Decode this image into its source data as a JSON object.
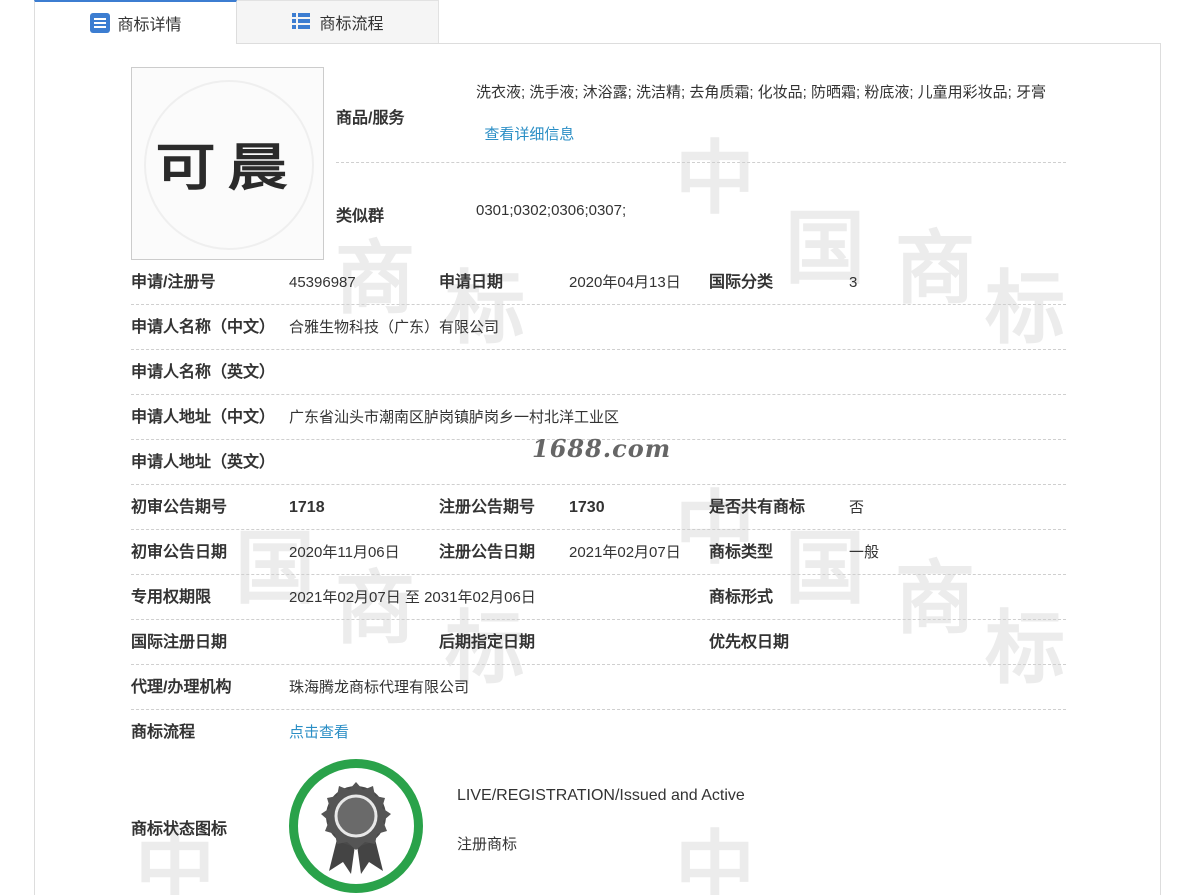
{
  "tabs": [
    {
      "label": "商标详情",
      "icon": "document-list-icon"
    },
    {
      "label": "商标流程",
      "icon": "grid-list-icon"
    }
  ],
  "logo": {
    "text": "可晨"
  },
  "goods": {
    "label": "商品/服务",
    "value": "洗衣液; 洗手液; 沐浴露; 洗洁精; 去角质霜; 化妆品; 防晒霜; 粉底液; 儿童用彩妆品; 牙膏",
    "detail_link": "查看详细信息"
  },
  "similar": {
    "label": "类似群",
    "value": "0301;0302;0306;0307;"
  },
  "fields": {
    "reg_no_label": "申请/注册号",
    "reg_no": "45396987",
    "apply_date_label": "申请日期",
    "apply_date": "2020年04月13日",
    "intl_class_label": "国际分类",
    "intl_class": "3",
    "applicant_cn_label": "申请人名称（中文）",
    "applicant_cn": "合雅生物科技（广东）有限公司",
    "applicant_en_label": "申请人名称（英文）",
    "applicant_en": "",
    "address_cn_label": "申请人地址（中文）",
    "address_cn": "广东省汕头市潮南区胪岗镇胪岗乡一村北洋工业区",
    "address_en_label": "申请人地址（英文）",
    "address_en": "",
    "prelim_no_label": "初审公告期号",
    "prelim_no": "1718",
    "reg_pub_no_label": "注册公告期号",
    "reg_pub_no": "1730",
    "shared_label": "是否共有商标",
    "shared": "否",
    "prelim_date_label": "初审公告日期",
    "prelim_date": "2020年11月06日",
    "reg_pub_date_label": "注册公告日期",
    "reg_pub_date": "2021年02月07日",
    "tm_type_label": "商标类型",
    "tm_type": "一般",
    "excl_period_label": "专用权期限",
    "excl_period": "2021年02月07日 至 2031年02月06日",
    "tm_form_label": "商标形式",
    "tm_form": "",
    "intl_reg_date_label": "国际注册日期",
    "intl_reg_date": "",
    "later_designation_label": "后期指定日期",
    "later_designation": "",
    "priority_date_label": "优先权日期",
    "priority_date": "",
    "agent_label": "代理/办理机构",
    "agent": "珠海腾龙商标代理有限公司",
    "flow_label": "商标流程",
    "flow_link": "点击查看"
  },
  "status": {
    "label": "商标状态图标",
    "en": "LIVE/REGISTRATION/Issued and Active",
    "cn": "注册商标",
    "icon": "award-ribbon-icon"
  },
  "overlay_text": "1688.com",
  "watermark": [
    "中",
    "国",
    "商",
    "标"
  ],
  "colors": {
    "accent": "#3c7dd1",
    "link": "#2a8ec5",
    "badge": "#2aa24a"
  }
}
